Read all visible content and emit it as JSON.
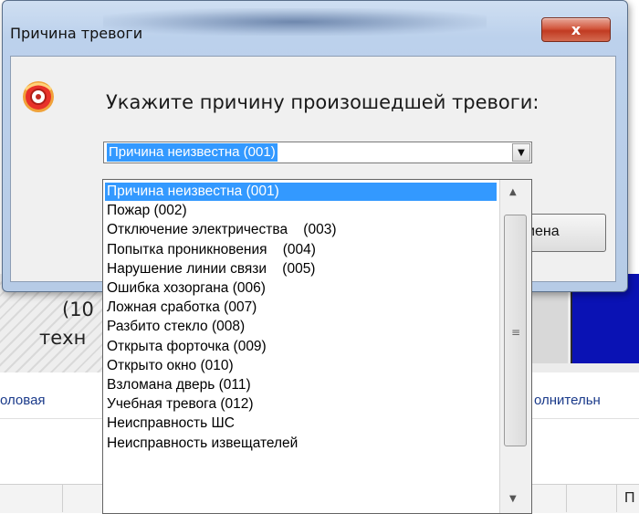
{
  "background": {
    "left_text_line1": "(10",
    "left_text_line2": "техн",
    "tab_left": "оловая",
    "tab_right": "олнительн",
    "column_label": "П"
  },
  "dialog": {
    "title": "Причина тревоги",
    "close_glyph": "x",
    "prompt": "Укажите причину произошедшей тревоги:",
    "combo_value": "Причина неизвестна (001)",
    "combo_arrow_glyph": "▼",
    "cancel_label": "мена"
  },
  "dropdown": {
    "items": [
      "Причина неизвестна (001)",
      "Пожар (002)",
      "Отключение электричества    (003)",
      "Попытка проникновения    (004)",
      "Нарушение линии связи    (005)",
      "Ошибка хозоргана (006)",
      "Ложная сработка (007)",
      "Разбито стекло (008)",
      "Открыта форточка (009)",
      "Открыто окно (010)",
      "Взломана дверь (011)",
      "Учебная тревога (012)",
      "Неисправность ШС",
      "Неисправность извещателей"
    ],
    "selected_index": 0,
    "scroll_up_glyph": "▲",
    "scroll_down_glyph": "▼",
    "scroll_grip_glyph": "≡"
  },
  "colors": {
    "selection": "#3399ff",
    "close_button": "#c13b22",
    "background_blue_panel": "#0a12b4"
  }
}
